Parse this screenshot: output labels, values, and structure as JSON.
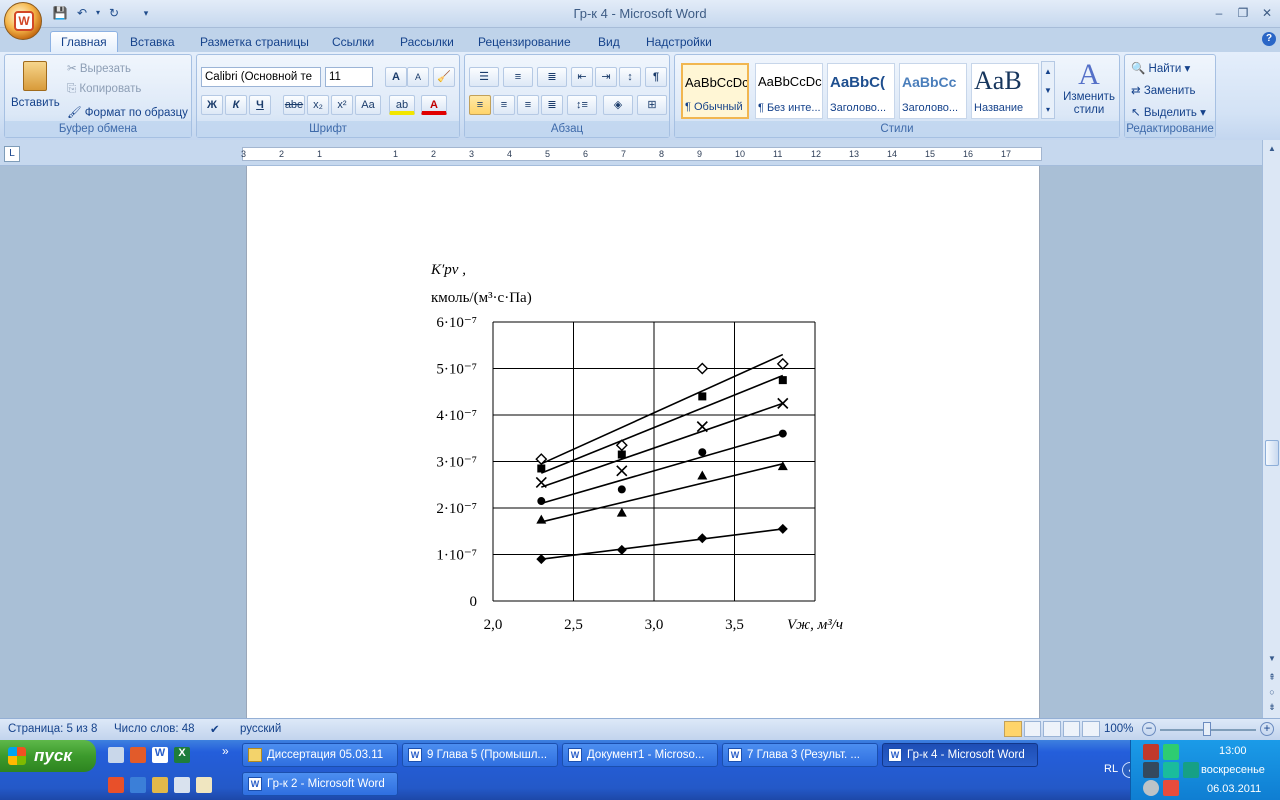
{
  "window": {
    "title": "Гр-к 4 - Microsoft Word",
    "office_logo": "W"
  },
  "tabs": [
    "Главная",
    "Вставка",
    "Разметка страницы",
    "Ссылки",
    "Рассылки",
    "Рецензирование",
    "Вид",
    "Надстройки"
  ],
  "ribbon": {
    "clipboard": {
      "paste": "Вставить",
      "cut": "Вырезать",
      "copy": "Копировать",
      "format_painter": "Формат по образцу",
      "label": "Буфер обмена"
    },
    "font": {
      "font_name": "Calibri (Основной те",
      "font_size": "11",
      "label": "Шрифт",
      "bold": "Ж",
      "italic": "К",
      "underline": "Ч",
      "strike": "abe",
      "sub": "x₂",
      "sup": "x²",
      "case": "Aa",
      "grow": "A",
      "shrink": "A"
    },
    "paragraph": {
      "label": "Абзац"
    },
    "styles": {
      "label": "Стили",
      "tiles": [
        {
          "preview": "AaBbCcDc",
          "name": "¶ Обычный"
        },
        {
          "preview": "AaBbCcDc",
          "name": "¶ Без инте..."
        },
        {
          "preview": "AaBbC(",
          "name": "Заголово..."
        },
        {
          "preview": "AaBbCc",
          "name": "Заголово..."
        },
        {
          "preview": "AaB",
          "name": "Название"
        }
      ],
      "change_styles": "Изменить стили"
    },
    "editing": {
      "find": "Найти",
      "replace": "Заменить",
      "select": "Выделить",
      "label": "Редактирование"
    }
  },
  "ruler": {
    "labels": [
      "3",
      "2",
      "1",
      "1",
      "2",
      "3",
      "4",
      "5",
      "6",
      "7",
      "8",
      "9",
      "10",
      "11",
      "12",
      "13",
      "14",
      "15",
      "16",
      "17"
    ]
  },
  "chart_data": {
    "type": "scatter",
    "ylabel": "K′pv ,",
    "yunit": "кмоль/(м³·с·Па)",
    "xlabel": "Vж, м³/ч",
    "xlim": [
      2.0,
      4.0
    ],
    "ylim": [
      0,
      6e-07
    ],
    "x_ticks": [
      "2,0",
      "2,5",
      "3,0",
      "3,5"
    ],
    "y_ticks": [
      "0",
      "1·10⁻⁷",
      "2·10⁻⁷",
      "3·10⁻⁷",
      "4·10⁻⁷",
      "5·10⁻⁷",
      "6·10⁻⁷"
    ],
    "grid": true,
    "series": [
      {
        "marker": "diamond-open",
        "points": [
          [
            2.3,
            3.05e-07
          ],
          [
            2.8,
            3.35e-07
          ],
          [
            3.3,
            5e-07
          ],
          [
            3.8,
            5.1e-07
          ]
        ],
        "fit": [
          [
            2.3,
            2.95e-07
          ],
          [
            3.8,
            5.3e-07
          ]
        ]
      },
      {
        "marker": "square",
        "points": [
          [
            2.3,
            2.85e-07
          ],
          [
            2.8,
            3.15e-07
          ],
          [
            3.3,
            4.4e-07
          ],
          [
            3.8,
            4.75e-07
          ]
        ],
        "fit": [
          [
            2.3,
            2.75e-07
          ],
          [
            3.8,
            4.85e-07
          ]
        ]
      },
      {
        "marker": "cross",
        "points": [
          [
            2.3,
            2.55e-07
          ],
          [
            2.8,
            2.8e-07
          ],
          [
            3.3,
            3.75e-07
          ],
          [
            3.8,
            4.25e-07
          ]
        ],
        "fit": [
          [
            2.3,
            2.45e-07
          ],
          [
            3.8,
            4.25e-07
          ]
        ]
      },
      {
        "marker": "circle",
        "points": [
          [
            2.3,
            2.15e-07
          ],
          [
            2.8,
            2.4e-07
          ],
          [
            3.3,
            3.2e-07
          ],
          [
            3.8,
            3.6e-07
          ]
        ],
        "fit": [
          [
            2.3,
            2.1e-07
          ],
          [
            3.8,
            3.6e-07
          ]
        ]
      },
      {
        "marker": "triangle",
        "points": [
          [
            2.3,
            1.75e-07
          ],
          [
            2.8,
            1.9e-07
          ],
          [
            3.3,
            2.7e-07
          ],
          [
            3.8,
            2.9e-07
          ]
        ],
        "fit": [
          [
            2.3,
            1.7e-07
          ],
          [
            3.8,
            2.95e-07
          ]
        ]
      },
      {
        "marker": "diamond",
        "points": [
          [
            2.3,
            9e-08
          ],
          [
            2.8,
            1.1e-07
          ],
          [
            3.3,
            1.35e-07
          ],
          [
            3.8,
            1.55e-07
          ]
        ],
        "fit": [
          [
            2.3,
            9e-08
          ],
          [
            3.8,
            1.55e-07
          ]
        ]
      }
    ]
  },
  "status": {
    "page": "Страница: 5 из 8",
    "words": "Число слов: 48",
    "language": "русский",
    "zoom": "100%"
  },
  "taskbar": {
    "start": "пуск",
    "buttons": [
      {
        "label": "Диссертация 05.03.11",
        "icon": "folder-icon",
        "active": false
      },
      {
        "label": "9 Глава 5 (Промышл...",
        "icon": "W",
        "active": false
      },
      {
        "label": "Документ1 - Microso...",
        "icon": "W",
        "active": false
      },
      {
        "label": "7 Глава 3 (Результ. ...",
        "icon": "W",
        "active": false
      },
      {
        "label": "Гр-к 4 - Microsoft Word",
        "icon": "W",
        "active": true
      },
      {
        "label": "Гр-к 2 - Microsoft Word",
        "icon": "W",
        "active": false
      }
    ],
    "tray": {
      "lang": "RL",
      "time": "13:00",
      "day": "воскресенье",
      "date": "06.03.2011"
    }
  }
}
